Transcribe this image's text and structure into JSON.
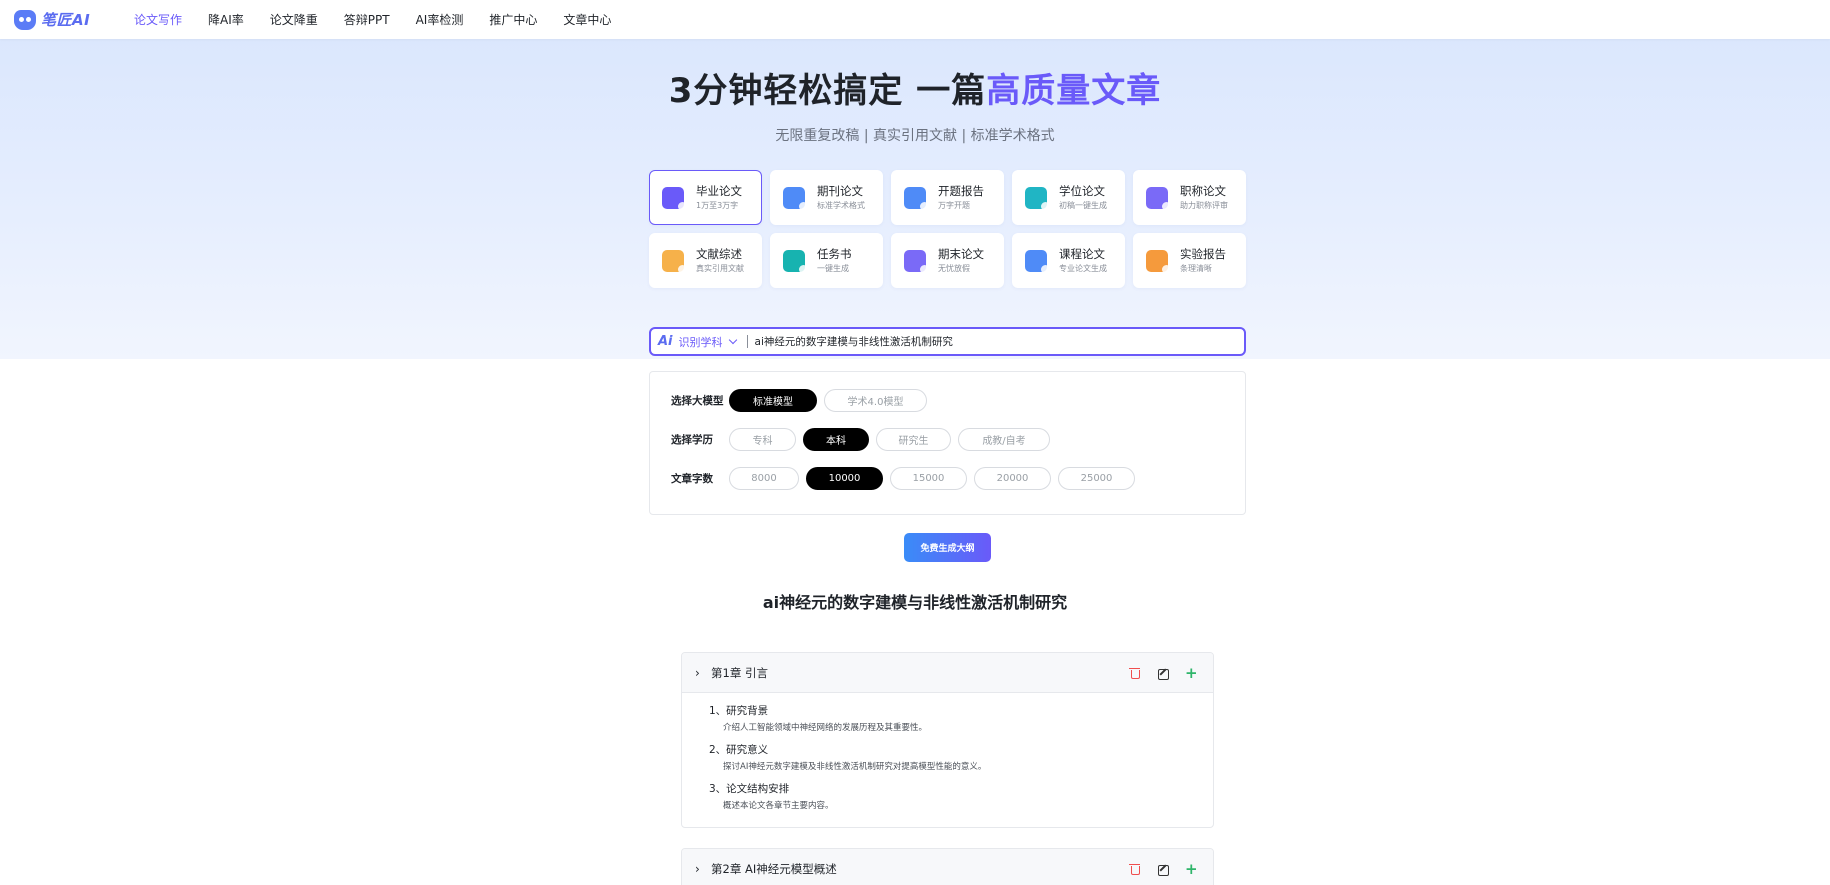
{
  "brand": {
    "logo_text": "笔匠AI"
  },
  "nav": {
    "items": [
      {
        "label": "论文写作",
        "active": true
      },
      {
        "label": "降AI率",
        "active": false
      },
      {
        "label": "论文降重",
        "active": false
      },
      {
        "label": "答辩PPT",
        "active": false
      },
      {
        "label": "AI率检测",
        "active": false
      },
      {
        "label": "推广中心",
        "active": false
      },
      {
        "label": "文章中心",
        "active": false
      }
    ]
  },
  "hero": {
    "title_main": "3分钟轻松搞定 一篇",
    "title_highlight": "高质量文章",
    "subtitle": "无限重复改稿 | 真实引用文献 | 标准学术格式"
  },
  "paper_types": [
    {
      "title": "毕业论文",
      "desc": "1万至3万字",
      "icon": "graduation-cap-icon",
      "color": "#6a5af9",
      "active": true
    },
    {
      "title": "期刊论文",
      "desc": "标准学术格式",
      "icon": "journal-icon",
      "color": "#4f8bf7",
      "active": false
    },
    {
      "title": "开题报告",
      "desc": "万字开题",
      "icon": "report-icon",
      "color": "#4f8bf7",
      "active": false
    },
    {
      "title": "学位论文",
      "desc": "初稿一键生成",
      "icon": "degree-icon",
      "color": "#20b5c4",
      "active": false
    },
    {
      "title": "职称论文",
      "desc": "助力职称评审",
      "icon": "title-paper-icon",
      "color": "#7a6af7",
      "active": false
    },
    {
      "title": "文献综述",
      "desc": "真实引用文献",
      "icon": "literature-icon",
      "color": "#f6b14a",
      "active": false
    },
    {
      "title": "任务书",
      "desc": "一键生成",
      "icon": "task-book-icon",
      "color": "#17b3b0",
      "active": false
    },
    {
      "title": "期末论文",
      "desc": "无忧放假",
      "icon": "calendar-icon",
      "color": "#7a6af7",
      "active": false
    },
    {
      "title": "课程论文",
      "desc": "专业论文生成",
      "icon": "course-paper-icon",
      "color": "#4f8bf7",
      "active": false
    },
    {
      "title": "实验报告",
      "desc": "条理清晰",
      "icon": "lab-report-icon",
      "color": "#f59a3c",
      "active": false
    }
  ],
  "search": {
    "ai_badge": "Ai",
    "subject_label": "识别学科",
    "value": "ai神经元的数字建模与非线性激活机制研究"
  },
  "options": {
    "model": {
      "label": "选择大模型",
      "choices": [
        {
          "label": "标准模型",
          "selected": true
        },
        {
          "label": "学术4.0模型",
          "selected": false
        }
      ]
    },
    "education": {
      "label": "选择学历",
      "choices": [
        {
          "label": "专科",
          "selected": false
        },
        {
          "label": "本科",
          "selected": true
        },
        {
          "label": "研究生",
          "selected": false
        },
        {
          "label": "成教/自考",
          "selected": false
        }
      ]
    },
    "word_count": {
      "label": "文章字数",
      "choices": [
        {
          "label": "8000",
          "selected": false
        },
        {
          "label": "10000",
          "selected": true
        },
        {
          "label": "15000",
          "selected": false
        },
        {
          "label": "20000",
          "selected": false
        },
        {
          "label": "25000",
          "selected": false
        }
      ]
    }
  },
  "generate_button": "免费生成大纲",
  "outline": {
    "title": "ai神经元的数字建模与非线性激活机制研究",
    "chapters": [
      {
        "caret": "›",
        "title": "第1章 引言",
        "sections": [
          {
            "title": "1、研究背景",
            "desc": "介绍人工智能领域中神经网络的发展历程及其重要性。"
          },
          {
            "title": "2、研究意义",
            "desc": "探讨AI神经元数字建模及非线性激活机制研究对提高模型性能的意义。"
          },
          {
            "title": "3、论文结构安排",
            "desc": "概述本论文各章节主要内容。"
          }
        ]
      },
      {
        "caret": "›",
        "title": "第2章 AI神经元模型概述",
        "sections": []
      }
    ],
    "plus_symbol": "+"
  }
}
